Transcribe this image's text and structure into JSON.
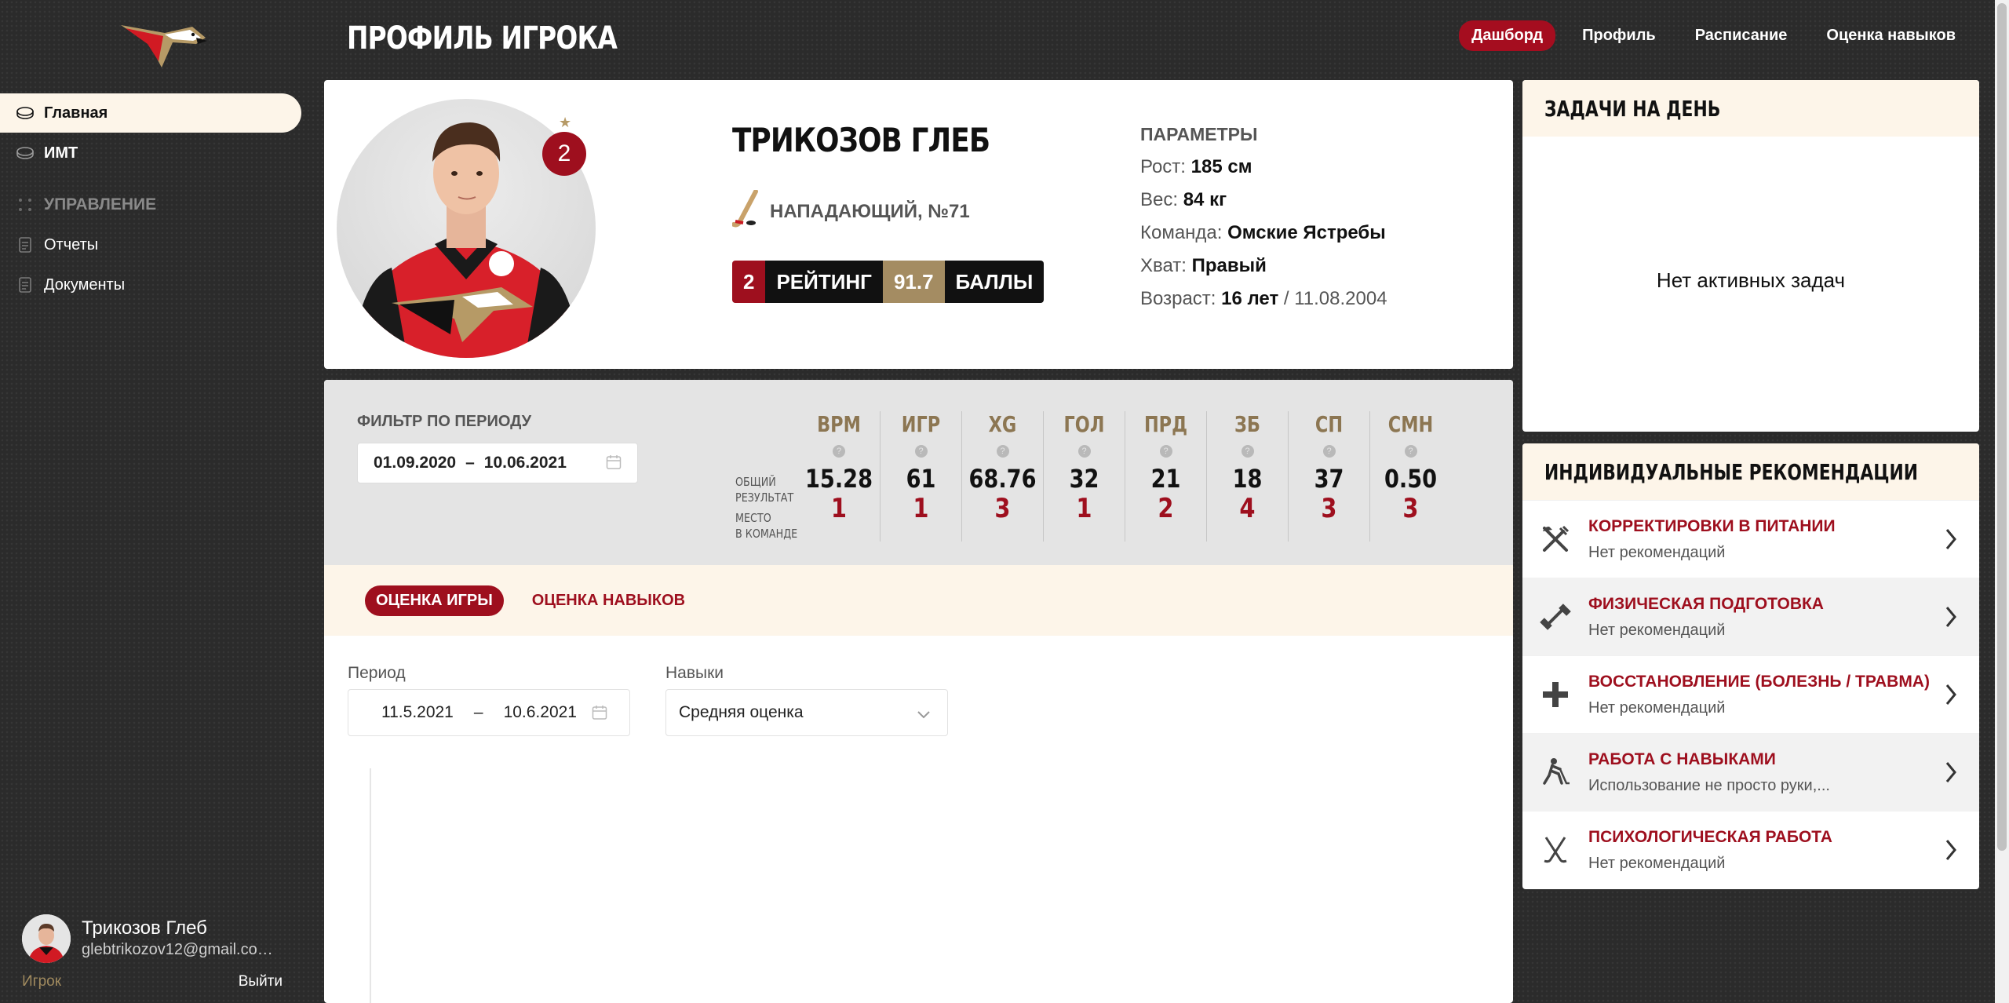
{
  "header": {
    "title": "ПРОФИЛЬ ИГРОКА"
  },
  "top_nav": [
    {
      "label": "Дашборд",
      "active": true
    },
    {
      "label": "Профиль"
    },
    {
      "label": "Расписание"
    },
    {
      "label": "Оценка навыков"
    }
  ],
  "sidebar": {
    "items": [
      {
        "label": "Главная",
        "icon": "puck-icon",
        "active": true
      },
      {
        "label": "ИМТ",
        "icon": "puck-icon"
      }
    ],
    "section_label": "УПРАВЛЕНИЕ",
    "sub_items": [
      {
        "label": "Отчеты",
        "icon": "document-icon"
      },
      {
        "label": "Документы",
        "icon": "document-icon"
      }
    ]
  },
  "user": {
    "name": "Трикозов Глеб",
    "email": "glebtrikozov12@gmail.com...",
    "role": "Игрок",
    "logout": "Выйти"
  },
  "profile": {
    "name": "ТРИКОЗОВ ГЛЕБ",
    "position": "НАПАДАЮЩИЙ, №71",
    "rank_badge": "2",
    "rating": {
      "place": "2",
      "label": "РЕЙТИНГ",
      "score": "91.7",
      "score_label": "БАЛЛЫ"
    },
    "params_title": "ПАРАМЕТРЫ",
    "params": [
      {
        "label": "Рост: ",
        "value": "185 см",
        "extra": ""
      },
      {
        "label": "Вес: ",
        "value": "84 кг",
        "extra": ""
      },
      {
        "label": "Команда: ",
        "value": "Омские Ястребы",
        "extra": ""
      },
      {
        "label": "Хват: ",
        "value": "Правый",
        "extra": ""
      },
      {
        "label": "Возраст: ",
        "value": "16 лет",
        "extra": " / 11.08.2004"
      }
    ]
  },
  "stats": {
    "filter_label": "ФИЛЬТР ПО ПЕРИОДУ",
    "date_from": "01.09.2020",
    "date_sep": "–",
    "date_to": "10.06.2021",
    "row_labels": {
      "total_1": "ОБЩИЙ",
      "total_2": "РЕЗУЛЬТАТ",
      "place_1": "МЕСТО",
      "place_2": "В КОМАНДЕ"
    },
    "columns": [
      {
        "h": "ВРМ",
        "v": "15.28",
        "p": "1"
      },
      {
        "h": "ИГР",
        "v": "61",
        "p": "1"
      },
      {
        "h": "XG",
        "v": "68.76",
        "p": "3"
      },
      {
        "h": "ГОЛ",
        "v": "32",
        "p": "1"
      },
      {
        "h": "ПРД",
        "v": "21",
        "p": "2"
      },
      {
        "h": "ЗБ",
        "v": "18",
        "p": "4"
      },
      {
        "h": "СП",
        "v": "37",
        "p": "3"
      },
      {
        "h": "СМН",
        "v": "0.50",
        "p": "3"
      }
    ]
  },
  "tabs": [
    {
      "label": "ОЦЕНКА ИГРЫ",
      "active": true
    },
    {
      "label": "ОЦЕНКА НАВЫКОВ"
    }
  ],
  "filters": {
    "period_label": "Период",
    "period_from": "11.5.2021",
    "period_sep": "–",
    "period_to": "10.6.2021",
    "skills_label": "Навыки",
    "skills_value": "Средняя оценка"
  },
  "tasks": {
    "title": "ЗАДАЧИ НА ДЕНЬ",
    "empty": "Нет активных задач"
  },
  "recommendations": {
    "title": "ИНДИВИДУАЛЬНЫЕ РЕКОМЕНДАЦИИ",
    "items": [
      {
        "title": "КОРРЕКТИРОВКИ В ПИТАНИИ",
        "sub": "Нет рекомендаций",
        "icon": "fork-knife-icon"
      },
      {
        "title": "ФИЗИЧЕСКАЯ ПОДГОТОВКА",
        "sub": "Нет рекомендаций",
        "icon": "dumbbell-icon"
      },
      {
        "title": "ВОССТАНОВЛЕНИЕ (БОЛЕЗНЬ / ТРАВМА)",
        "sub": "Нет рекомендаций",
        "icon": "plus-icon"
      },
      {
        "title": "РАБОТА С НАВЫКАМИ",
        "sub": "Использование не просто руки,...",
        "icon": "hockey-player-icon"
      },
      {
        "title": "ПСИХОЛОГИЧЕСКАЯ РАБОТА",
        "sub": "Нет рекомендаций",
        "icon": "crossed-sticks-icon"
      }
    ]
  },
  "colors": {
    "accent": "#9e0f1e",
    "gold": "#a48c62",
    "cream": "#fdf5e9",
    "dark_bg": "#2b2b2b"
  }
}
